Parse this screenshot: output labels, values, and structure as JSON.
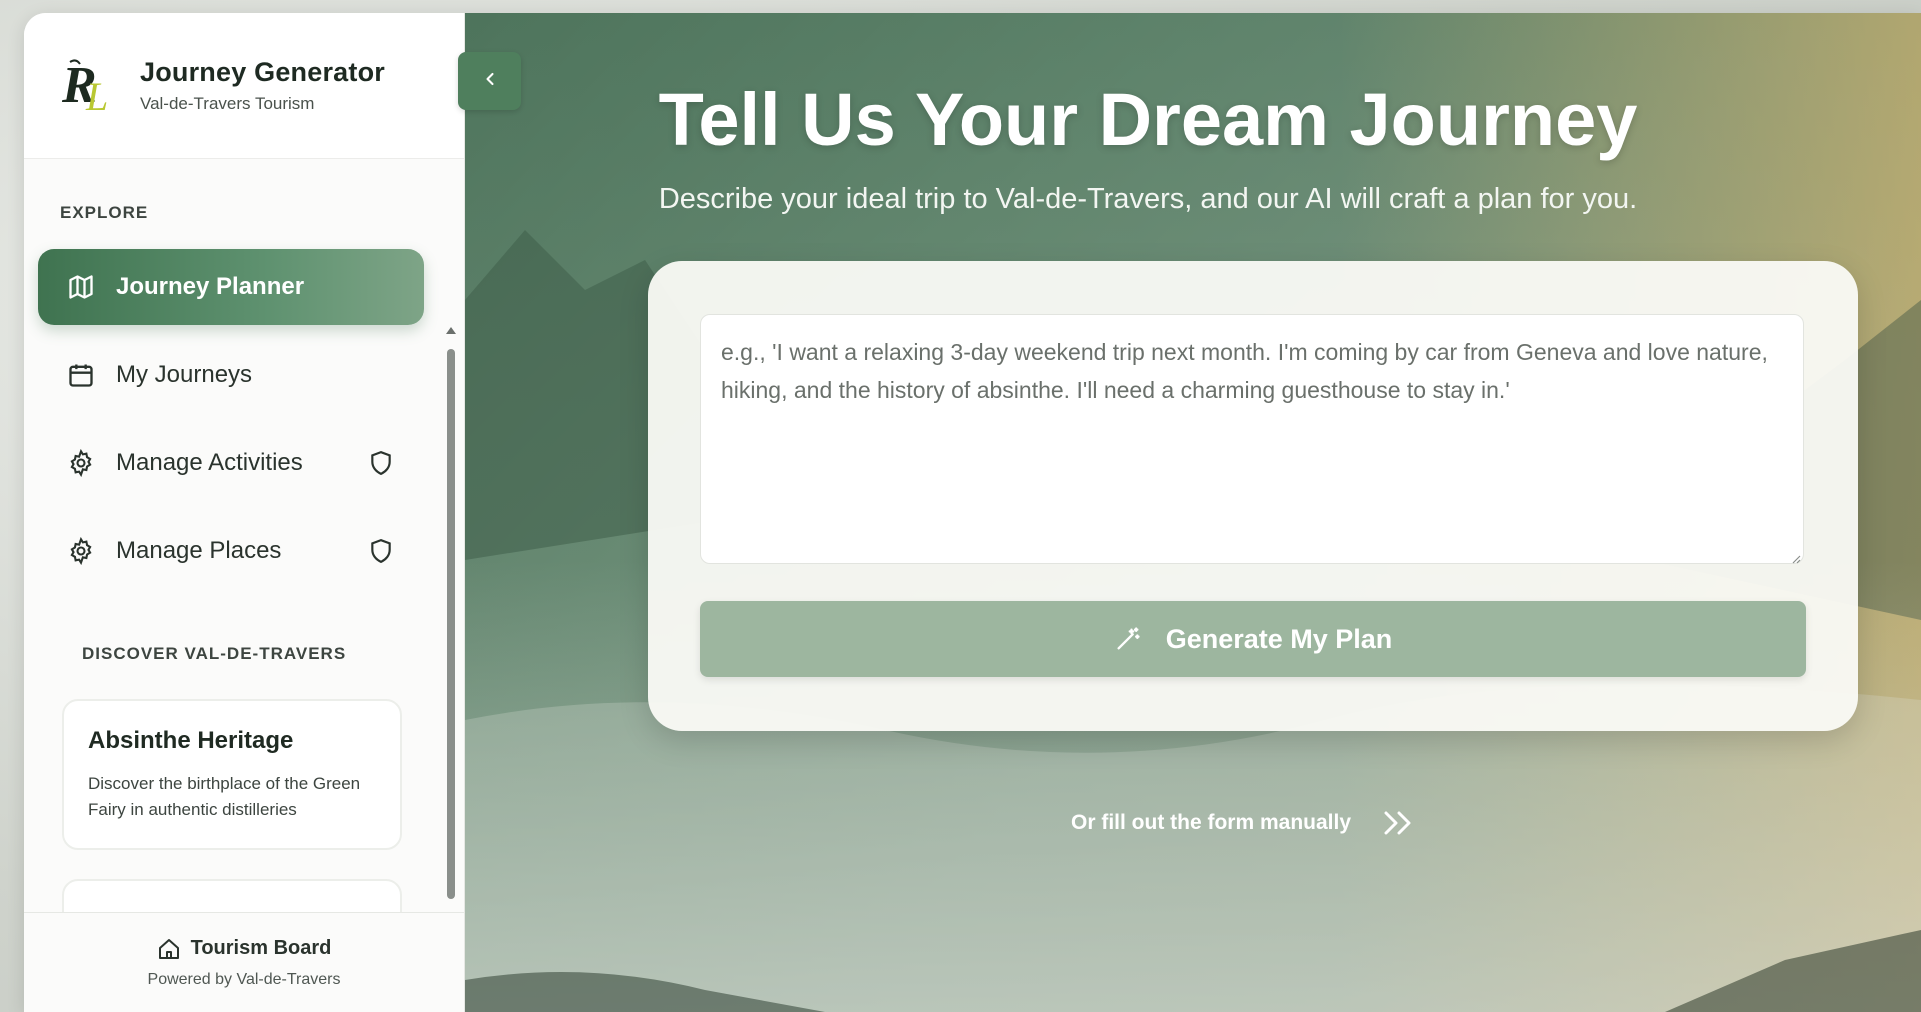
{
  "brand": {
    "title": "Journey Generator",
    "subtitle": "Val-de-Travers Tourism",
    "logo_icon": "rl-monogram-logo"
  },
  "sidebar": {
    "collapse_icon": "chevron-left-icon",
    "sections": {
      "explore": "EXPLORE",
      "discover": "DISCOVER VAL-DE-TRAVERS"
    },
    "items": [
      {
        "label": "Journey Planner",
        "icon": "map-icon",
        "active": true
      },
      {
        "label": "My Journeys",
        "icon": "calendar-icon",
        "active": false
      },
      {
        "label": "Manage Activities",
        "icon": "gear-icon",
        "badge_icon": "shield-icon",
        "active": false
      },
      {
        "label": "Manage Places",
        "icon": "gear-icon",
        "badge_icon": "shield-icon",
        "active": false
      }
    ],
    "cards": [
      {
        "title": "Absinthe Heritage",
        "text": "Discover the birthplace of the Green Fairy in authentic distilleries"
      }
    ],
    "footer": {
      "title": "Tourism Board",
      "subtitle": "Powered by Val-de-Travers",
      "icon": "home-icon"
    }
  },
  "main": {
    "title": "Tell Us Your Dream Journey",
    "subtitle": "Describe your ideal trip to Val-de-Travers, and our AI will craft a plan for you.",
    "prompt": {
      "placeholder": "e.g., 'I want a relaxing 3-day weekend trip next month. I'm coming by car from Geneva and love nature, hiking, and the history of absinthe. I'll need a charming guesthouse to stay in.'",
      "value": ""
    },
    "generate_label": "Generate My Plan",
    "generate_icon": "magic-wand-icon",
    "manual_label": "Or fill out the form manually",
    "manual_icon": "double-chevron-right-icon"
  },
  "colors": {
    "accent": "#3f7350",
    "button": "#9db69f",
    "sidebar_bg": "#fbfbfa"
  }
}
